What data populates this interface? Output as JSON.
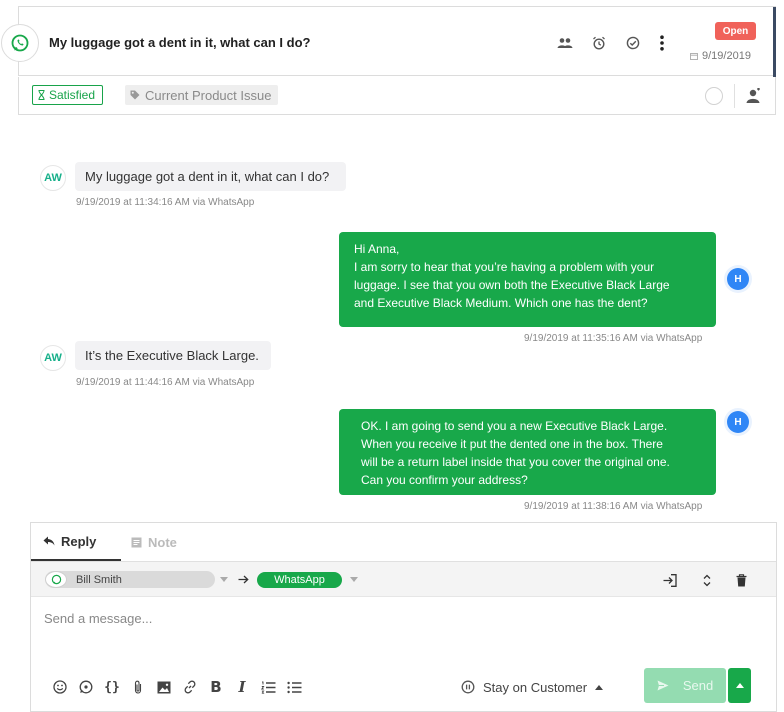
{
  "header": {
    "title": "My luggage got a dent in it, what can I do?",
    "status": "Open",
    "date": "9/19/2019",
    "icons": [
      "whatsapp-icon",
      "users-icon",
      "alarm-clock-icon",
      "check-circle-icon",
      "more-vertical-icon",
      "calendar-icon"
    ]
  },
  "tags": {
    "satisfaction": "Satisfied",
    "category": "Current Product Issue"
  },
  "messages": [
    {
      "direction": "in",
      "avatar": "AW",
      "text": "My luggage got a dent in it, what can I do?",
      "meta": "9/19/2019 at 11:34:16 AM via WhatsApp"
    },
    {
      "direction": "out",
      "avatar": "H",
      "lines": [
        "Hi Anna,",
        "I am sorry to hear that you’re having a problem with your",
        "luggage. I see that you own both the Executive Black Large",
        "and Executive Black Medium. Which one has the dent?"
      ],
      "meta": "9/19/2019 at 11:35:16 AM via WhatsApp"
    },
    {
      "direction": "in",
      "avatar": "AW",
      "text": "It’s the Executive Black Large.",
      "meta": "9/19/2019 at 11:44:16 AM via WhatsApp"
    },
    {
      "direction": "out",
      "avatar": "H",
      "lines": [
        "OK. I am going to send you a new Executive Black Large.",
        "When you receive it put the dented one in the box. There",
        "will be a return label inside that you cover the original one.",
        "Can you confirm your address?"
      ],
      "meta": "9/19/2019 at 11:38:16 AM via WhatsApp"
    }
  ],
  "composer": {
    "tab_reply": "Reply",
    "tab_note": "Note",
    "from_name": "Bill Smith",
    "channel": "WhatsApp",
    "placeholder": "Send a message...",
    "stay_label": "Stay on Customer",
    "send_label": "Send"
  },
  "colors": {
    "brand_green": "#18a84a",
    "open_red": "#f0625a",
    "agent_blue": "#2f86f6",
    "customer_teal": "#17b08a"
  }
}
